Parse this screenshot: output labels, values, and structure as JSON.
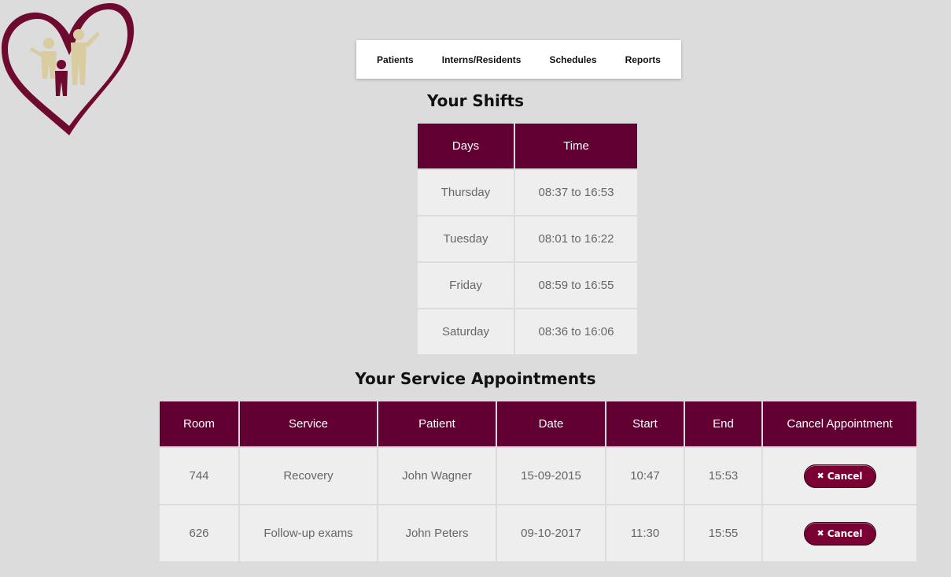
{
  "nav": {
    "items": [
      "Patients",
      "Interns/Residents",
      "Schedules",
      "Reports"
    ]
  },
  "shifts": {
    "title": "Your Shifts",
    "headers": [
      "Days",
      "Time"
    ],
    "rows": [
      [
        "Thursday",
        "08:37 to 16:53"
      ],
      [
        "Tuesday",
        "08:01 to 16:22"
      ],
      [
        "Friday",
        "08:59 to 16:55"
      ],
      [
        "Saturday",
        "08:36 to 16:06"
      ]
    ]
  },
  "appointments": {
    "title": "Your Service Appointments",
    "headers": [
      "Room",
      "Service",
      "Patient",
      "Date",
      "Start",
      "End",
      "Cancel Appointment"
    ],
    "rows": [
      [
        "744",
        "Recovery",
        "John Wagner",
        "15-09-2015",
        "10:47",
        "15:53"
      ],
      [
        "626",
        "Follow-up exams",
        "John Peters",
        "09-10-2017",
        "11:30",
        "15:55"
      ]
    ],
    "cancel_label": "Cancel",
    "cancel_icon": "x-icon"
  },
  "colors": {
    "accent": "#630033",
    "button": "#7a0033",
    "background": "#dcdcdc",
    "logo_gold": "#d8ccA0"
  }
}
